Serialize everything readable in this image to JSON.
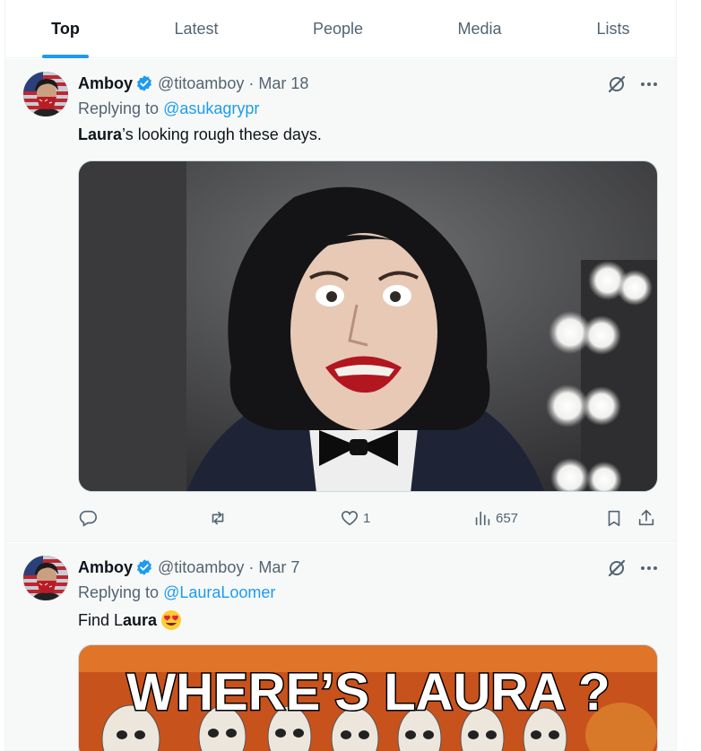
{
  "tabs": [
    {
      "label": "Top",
      "active": true
    },
    {
      "label": "Latest",
      "active": false
    },
    {
      "label": "People",
      "active": false
    },
    {
      "label": "Media",
      "active": false
    },
    {
      "label": "Lists",
      "active": false
    }
  ],
  "tweets": [
    {
      "name": "Amboy",
      "handle": "@titoamboy",
      "separator": "·",
      "date": "Mar 18",
      "reply_prefix": "Replying to",
      "reply_to": "@asukagrypr",
      "text_bold": "Laura",
      "text_rest": "’s looking rough these days.",
      "actions": {
        "replies": "",
        "reposts": "",
        "likes": "1",
        "views": "657"
      }
    },
    {
      "name": "Amboy",
      "handle": "@titoamboy",
      "separator": "·",
      "date": "Mar 7",
      "reply_prefix": "Replying to",
      "reply_to": "@LauraLoomer",
      "text_plain": "Find L",
      "text_bold": "aura",
      "text_emoji": "smiling-face-with-heart-eyes-icon",
      "media_caption": "WHERE’S LAURA ?"
    }
  ],
  "colors": {
    "accent": "#1d9bf0",
    "secondary_text": "#536471",
    "background": "#f7f9f9"
  }
}
